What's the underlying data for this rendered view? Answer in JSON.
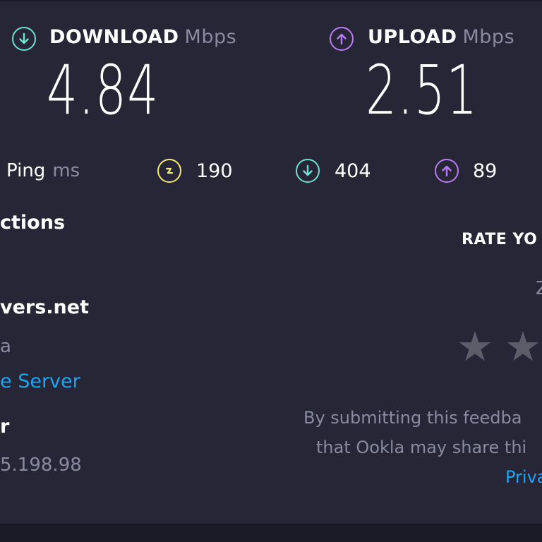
{
  "download": {
    "label": "DOWNLOAD",
    "unit": "Mbps",
    "value": "4.84"
  },
  "upload": {
    "label": "UPLOAD",
    "unit": "Mbps",
    "value": "2.51"
  },
  "ping": {
    "label": "Ping",
    "unit": "ms",
    "idle": "190",
    "download": "404",
    "upload": "89"
  },
  "connections": {
    "heading": "ctions"
  },
  "server": {
    "name": "vers.net",
    "location": "a",
    "change_link": "e Server",
    "isp_label": "r",
    "ip": "5.198.98"
  },
  "rating": {
    "heading": "RATE YO",
    "scale_hint": "Z",
    "stars": 5,
    "disclaimer_line1": "By submitting this feedba",
    "disclaimer_line2": "that Ookla may share thi",
    "privacy_link": "Priva"
  },
  "colors": {
    "background": "#262637",
    "download_accent": "#6fe0d4",
    "upload_accent": "#bb7bf2",
    "ping_accent": "#f2e878",
    "link": "#1ba6f2",
    "muted": "#8a8aa0",
    "star_inactive": "#5d5d6a"
  },
  "icons": {
    "download": "arrow-down-circle-icon",
    "upload": "arrow-up-circle-icon",
    "ping": "jitter-circle-icon"
  }
}
